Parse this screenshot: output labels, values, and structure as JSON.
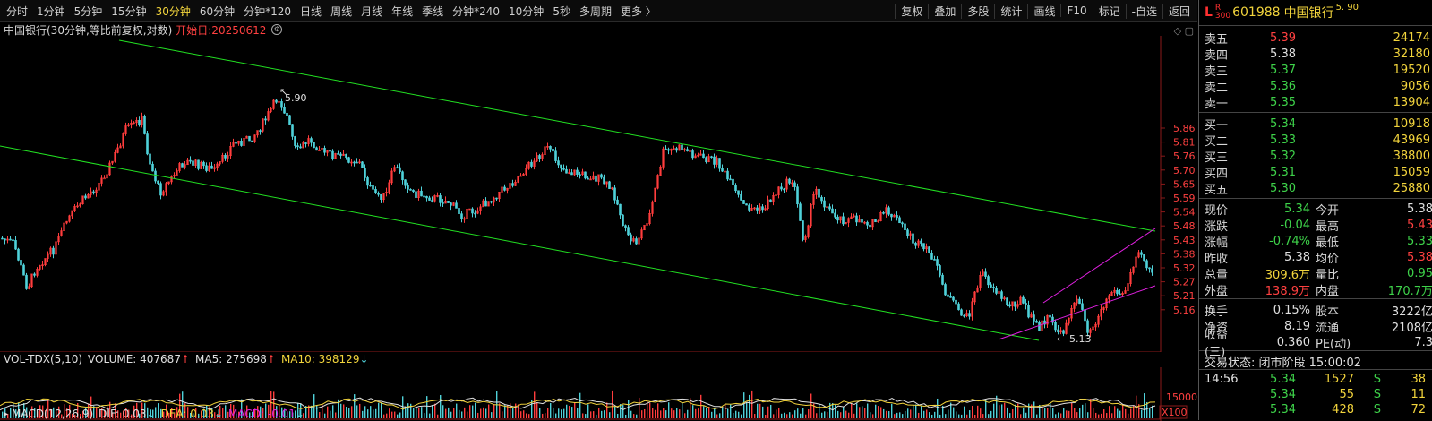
{
  "toolbar": {
    "periods": [
      "分时",
      "1分钟",
      "5分钟",
      "15分钟",
      "30分钟",
      "60分钟",
      "分钟*120",
      "日线",
      "周线",
      "月线",
      "年线",
      "季线",
      "分钟*240",
      "10分钟",
      "5秒",
      "多周期",
      "更多 〉"
    ],
    "active_period": "30分钟",
    "right": [
      "复权",
      "叠加",
      "多股",
      "统计",
      "画线",
      "F10",
      "标记",
      "-自选",
      "返回"
    ]
  },
  "chart": {
    "title": "中国银行(30分钟,等比前复权,对数)",
    "start_date": "开始日:20250612",
    "high_label": "5.90",
    "low_label": "5.13",
    "y_ticks": [
      "5.86",
      "5.81",
      "5.76",
      "5.70",
      "5.65",
      "5.59",
      "5.54",
      "5.48",
      "5.43",
      "5.38",
      "5.32",
      "5.27",
      "5.21",
      "5.16"
    ],
    "volume_tick": "15000",
    "volume_unit": "X100",
    "colors": {
      "up": "#ff3d3d",
      "down": "#4fd1d9",
      "channel": "#22e022",
      "channel2": "#e020e0"
    }
  },
  "volume_line": {
    "name": "VOL-TDX(5,10)",
    "volume": "VOLUME: 407687",
    "ma5": "MA5: 275698",
    "ma10": "MA10: 398129"
  },
  "macd_line": {
    "name": "MACD(12,26,9)",
    "dif": "DIF: 0.03",
    "dea": "DEA: 0.03",
    "macd": "MACD: -0.01"
  },
  "panel": {
    "L": "L",
    "R": "R",
    "R_sub": "300",
    "code": "601988",
    "name": "中国银行",
    "price_tag": "5. 90",
    "asks": [
      {
        "label": "卖五",
        "price": "5.39",
        "vol": "24174",
        "color": "red"
      },
      {
        "label": "卖四",
        "price": "5.38",
        "vol": "32180",
        "color": "white"
      },
      {
        "label": "卖三",
        "price": "5.37",
        "vol": "19520",
        "color": "green"
      },
      {
        "label": "卖二",
        "price": "5.36",
        "vol": "9056",
        "color": "green"
      },
      {
        "label": "卖一",
        "price": "5.35",
        "vol": "13904",
        "color": "green"
      }
    ],
    "bids": [
      {
        "label": "买一",
        "price": "5.34",
        "vol": "10918",
        "color": "green"
      },
      {
        "label": "买二",
        "price": "5.33",
        "vol": "43969",
        "color": "green"
      },
      {
        "label": "买三",
        "price": "5.32",
        "vol": "38800",
        "color": "green"
      },
      {
        "label": "买四",
        "price": "5.31",
        "vol": "15059",
        "color": "green"
      },
      {
        "label": "买五",
        "price": "5.30",
        "vol": "25880",
        "color": "green"
      }
    ],
    "stats": [
      {
        "l1": "现价",
        "v1": "5.34",
        "c1": "green",
        "l2": "今开",
        "v2": "5.38",
        "c2": "white"
      },
      {
        "l1": "涨跌",
        "v1": "-0.04",
        "c1": "green",
        "l2": "最高",
        "v2": "5.43",
        "c2": "red"
      },
      {
        "l1": "涨幅",
        "v1": "-0.74%",
        "c1": "green",
        "l2": "最低",
        "v2": "5.33",
        "c2": "green"
      },
      {
        "l1": "昨收",
        "v1": "5.38",
        "c1": "white",
        "l2": "均价",
        "v2": "5.38",
        "c2": "red"
      },
      {
        "l1": "总量",
        "v1": "309.6万",
        "c1": "yellow",
        "l2": "量比",
        "v2": "0.95",
        "c2": "green"
      },
      {
        "l1": "外盘",
        "v1": "138.9万",
        "c1": "red",
        "l2": "内盘",
        "v2": "170.7万",
        "c2": "green"
      }
    ],
    "stats2": [
      {
        "l1": "换手",
        "v1": "0.15%",
        "c1": "white",
        "l2": "股本",
        "v2": "3222亿",
        "c2": "white"
      },
      {
        "l1": "净资",
        "v1": "8.19",
        "c1": "white",
        "l2": "流通",
        "v2": "2108亿",
        "c2": "white"
      },
      {
        "l1": "收益(三)",
        "v1": "0.360",
        "c1": "white",
        "l2": "PE(动)",
        "v2": "7.3",
        "c2": "white"
      }
    ],
    "trade_status": "交易状态: 闭市阶段 15:00:02",
    "ticks": [
      {
        "time": "14:56",
        "price": "5.34",
        "vol": "1527",
        "side": "S",
        "num": "38"
      },
      {
        "time": "",
        "price": "5.34",
        "vol": "55",
        "side": "S",
        "num": "11"
      },
      {
        "time": "",
        "price": "5.34",
        "vol": "428",
        "side": "S",
        "num": "72"
      }
    ]
  }
}
